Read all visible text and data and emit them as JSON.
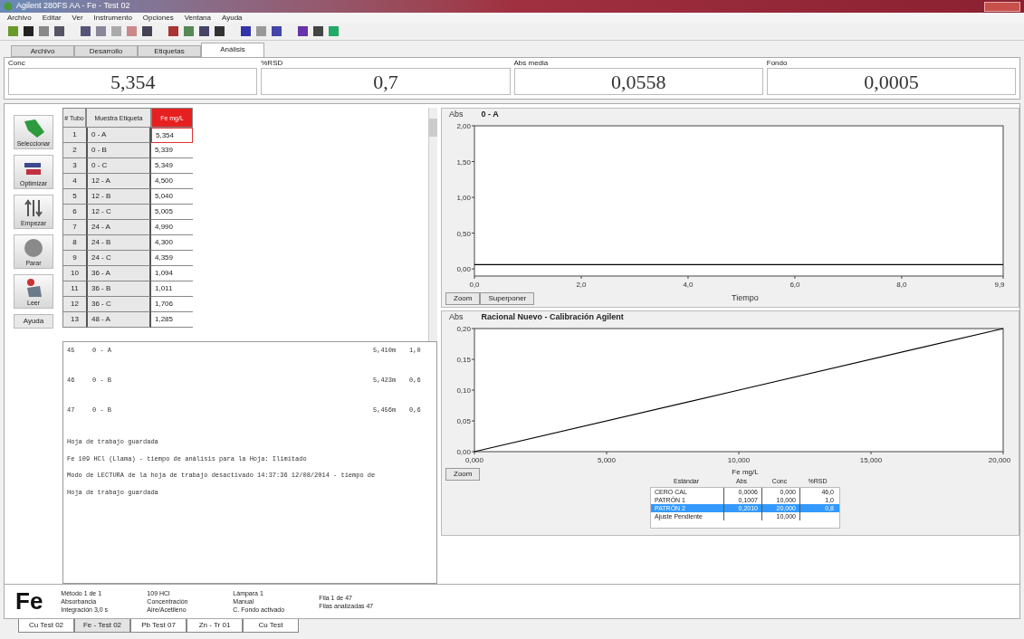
{
  "window": {
    "title": "Agilent 280FS AA - Fe - Test 02"
  },
  "menu": [
    "Archivo",
    "Editar",
    "Ver",
    "Instrumento",
    "Opciones",
    "Ventana",
    "Ayuda"
  ],
  "tabs": [
    {
      "label": "Archivo",
      "selected": false
    },
    {
      "label": "Desarrollo",
      "selected": false
    },
    {
      "label": "Etiquetas",
      "selected": false
    },
    {
      "label": "Análisis",
      "selected": true
    }
  ],
  "readouts": [
    {
      "label": "Conc",
      "value": "5,354"
    },
    {
      "label": "%RSD",
      "value": "0,7"
    },
    {
      "label": "Abs media",
      "value": "0,0558"
    },
    {
      "label": "Fondo",
      "value": "0,0005"
    }
  ],
  "side_buttons": [
    {
      "label": "Seleccionar",
      "kind": "select"
    },
    {
      "label": "Optimizar",
      "kind": "optimize"
    },
    {
      "label": "Empezar",
      "kind": "start"
    },
    {
      "label": "Parar",
      "kind": "stop"
    },
    {
      "label": "Leer",
      "kind": "read"
    }
  ],
  "help_button": "Ayuda",
  "table": {
    "columns": [
      "# Tubo",
      "Muestra Etiqueta",
      "Fe mg/L"
    ],
    "rows": [
      {
        "cells": [
          "1",
          "0 - A",
          "5,354"
        ],
        "selected": true
      },
      {
        "cells": [
          "2",
          "0 - B",
          "5,339"
        ],
        "selected": false
      },
      {
        "cells": [
          "3",
          "0 - C",
          "5,349"
        ],
        "selected": false
      },
      {
        "cells": [
          "4",
          "12 - A",
          "4,500"
        ],
        "selected": false
      },
      {
        "cells": [
          "5",
          "12 - B",
          "5,040"
        ],
        "selected": false
      },
      {
        "cells": [
          "6",
          "12 - C",
          "5,005"
        ],
        "selected": false
      },
      {
        "cells": [
          "7",
          "24 - A",
          "4,990"
        ],
        "selected": false
      },
      {
        "cells": [
          "8",
          "24 - B",
          "4,300"
        ],
        "selected": false
      },
      {
        "cells": [
          "9",
          "24 - C",
          "4,359"
        ],
        "selected": false
      },
      {
        "cells": [
          "10",
          "36 - A",
          "1,094"
        ],
        "selected": false
      },
      {
        "cells": [
          "11",
          "36 - B",
          "1,011"
        ],
        "selected": false
      },
      {
        "cells": [
          "12",
          "36 - C",
          "1,706"
        ],
        "selected": false
      },
      {
        "cells": [
          "13",
          "48 - A",
          "1,285"
        ],
        "selected": false
      }
    ]
  },
  "log": {
    "results": [
      {
        "num": "45",
        "label": "0 - A",
        "conc": "5,410m",
        "rsd": "1,0"
      },
      {
        "num": "46",
        "label": "0 - B",
        "conc": "5,423m",
        "rsd": "0,6"
      },
      {
        "num": "47",
        "label": "0 - B",
        "conc": "5,456m",
        "rsd": "0,6"
      }
    ],
    "messages": [
      "Hoja de trabajo guardada",
      "Fe 109 HCl (Llama) - tiempo de análisis para la Hoja: Ilimitado",
      "Modo de LECTURA de la hoja de trabajo desactivado 14:37:36 12/08/2014 - tiempo de",
      "Hoja de trabajo guardada"
    ]
  },
  "signal_chart": {
    "chart_data": {
      "type": "line",
      "title": "0 - A",
      "ylabel": "Abs",
      "xlabel": "Tiempo",
      "x": [
        0,
        9.9
      ],
      "series": [
        {
          "color": "#000000",
          "values": [
            0.06,
            0.06
          ]
        }
      ],
      "xlim": [
        0,
        9.9
      ],
      "ylim": [
        -0.1,
        2
      ],
      "xticks": [
        {
          "value": 0,
          "label": "0,0"
        },
        {
          "value": 2,
          "label": "2,0"
        },
        {
          "value": 4,
          "label": "4,0"
        },
        {
          "value": 6,
          "label": "6,0"
        },
        {
          "value": 8,
          "label": "8,0"
        },
        {
          "value": 9.9,
          "label": "9,9"
        }
      ],
      "yticks": [
        {
          "value": 0,
          "label": "0,00"
        },
        {
          "value": 0.5,
          "label": "0,50"
        },
        {
          "value": 1,
          "label": "1,00"
        },
        {
          "value": 1.5,
          "label": "1,50"
        },
        {
          "value": 2,
          "label": "2,00"
        }
      ]
    },
    "buttons": [
      "Zoom",
      "Superponer"
    ]
  },
  "calibration_chart": {
    "chart_data": {
      "type": "line",
      "title": "Racional Nuevo - Calibración Agilent",
      "ylabel": "Abs",
      "xlabel": "Fe mg/L",
      "x": [
        0,
        10,
        20
      ],
      "series": [
        {
          "color": "#000000",
          "values": [
            0,
            0.1,
            0.2
          ]
        }
      ],
      "xlim": [
        0,
        20
      ],
      "ylim": [
        0,
        0.2
      ],
      "xticks": [
        {
          "value": 0,
          "label": "0,000"
        },
        {
          "value": 5,
          "label": "5,000"
        },
        {
          "value": 10,
          "label": "10,000"
        },
        {
          "value": 15,
          "label": "15,000"
        },
        {
          "value": 20,
          "label": "20,000"
        }
      ],
      "yticks": [
        {
          "value": 0,
          "label": "0,00"
        },
        {
          "value": 0.05,
          "label": "0,05"
        },
        {
          "value": 0.1,
          "label": "0,10"
        },
        {
          "value": 0.15,
          "label": "0,15"
        },
        {
          "value": 0.2,
          "label": "0,20"
        }
      ]
    },
    "buttons": [
      "Zoom"
    ],
    "legend": {
      "columns": [
        "Estándar",
        "Abs",
        "Conc",
        "%RSD"
      ],
      "rows": [
        {
          "cells": [
            "CERO CAL",
            "0,0006",
            "0,000",
            "46,0"
          ],
          "selected": false
        },
        {
          "cells": [
            "PATRÓN 1",
            "0,1007",
            "10,000",
            "1,0"
          ],
          "selected": false
        },
        {
          "cells": [
            "PATRÓN 2",
            "0,2010",
            "20,000",
            "0,8"
          ],
          "selected": true
        },
        {
          "cells": [
            "Ajuste Pendiente",
            "",
            "10,000",
            ""
          ],
          "selected": false
        }
      ]
    }
  },
  "status": {
    "element": "Fe",
    "columns": [
      [
        "Método 1 de 1",
        "Absorbancia",
        "Integración 3,0 s"
      ],
      [
        "109 HCl",
        "Concentración",
        "Aire/Acetileno"
      ],
      [
        "Lámpara 1",
        "Manual",
        "C. Fondo activado"
      ],
      [
        "Fila 1 de 47",
        "Filas analizadas 47"
      ]
    ]
  },
  "worksheet_tabs": [
    {
      "label": "Cu Test 02",
      "selected": false
    },
    {
      "label": "Fe - Test 02",
      "selected": true
    },
    {
      "label": "Pb Test 07",
      "selected": false
    },
    {
      "label": "Zn - Tr 01",
      "selected": false
    },
    {
      "label": "Cu Test",
      "selected": false
    }
  ]
}
